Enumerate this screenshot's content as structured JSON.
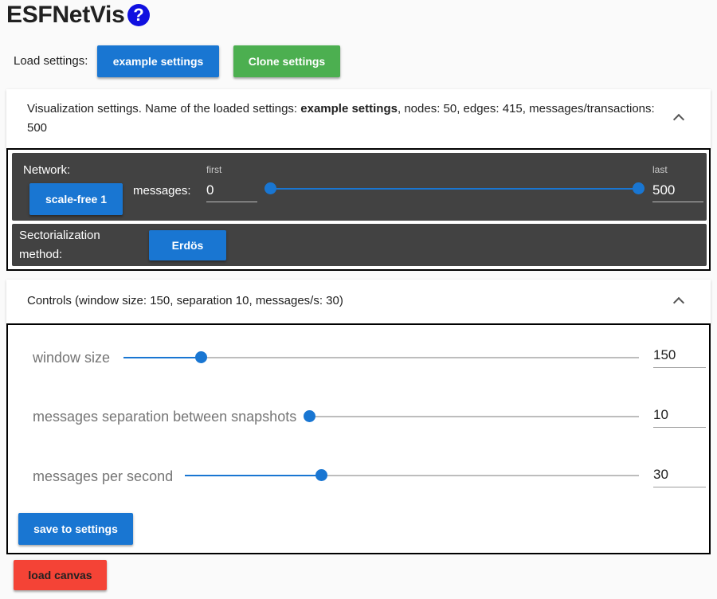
{
  "header": {
    "title": "ESFNetVis",
    "help_glyph": "?"
  },
  "load_settings": {
    "label": "Load settings:",
    "example_button": "example settings",
    "clone_button": "Clone settings"
  },
  "visualization": {
    "header_prefix": "Visualization settings. Name of the loaded settings: ",
    "settings_name": "example settings",
    "header_suffix": ", nodes: 50, edges: 415, messages/transactions: 500",
    "network_label": "Network:",
    "network_button": "scale-free 1",
    "messages_label": "messages:",
    "first_caption": "first",
    "last_caption": "last",
    "first_value": "0",
    "last_value": "500",
    "range": {
      "min": 0,
      "max": 500,
      "first": 0,
      "last": 500
    },
    "sectorialization_label": "Sectorialization method:",
    "sectorialization_button": "Erdös"
  },
  "controls": {
    "header": "Controls (window size: 150, separation 10, messages/s: 30)",
    "window_size": {
      "label": "window size",
      "value": "150",
      "fraction": 0.15
    },
    "separation": {
      "label": "messages separation between snapshots",
      "value": "10",
      "fraction": 0.0
    },
    "per_second": {
      "label": "messages per second",
      "value": "30",
      "fraction": 0.3
    },
    "save_button": "save to settings"
  },
  "load_canvas_button": "load canvas",
  "colors": {
    "primary": "#1976d2",
    "green": "#4caf50",
    "red": "#f44336",
    "dark_panel": "#424242",
    "help_icon": "#1010e0"
  },
  "icons": {
    "help": "help-circle-icon",
    "collapse": "chevron-up-icon"
  }
}
